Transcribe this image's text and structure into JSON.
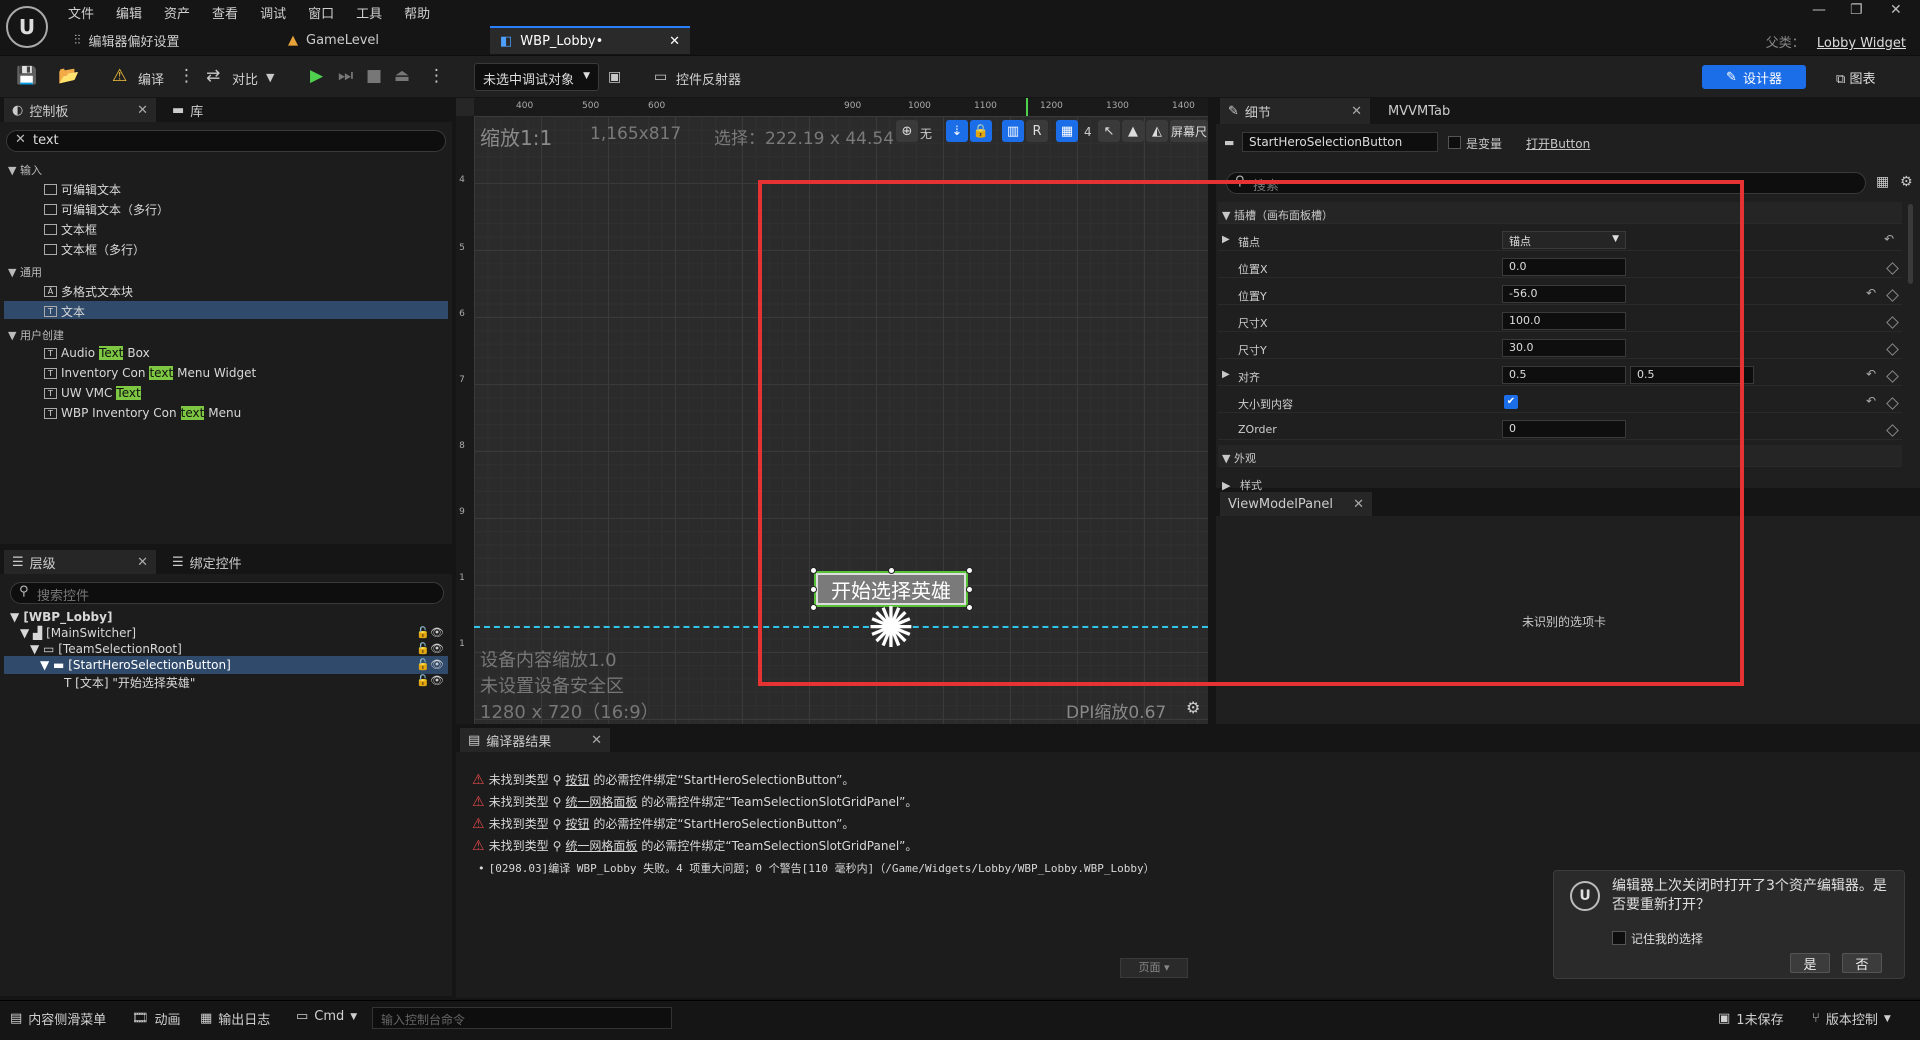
{
  "menu": [
    "文件",
    "编辑",
    "资产",
    "查看",
    "调试",
    "窗口",
    "工具",
    "帮助"
  ],
  "doc_tabs": {
    "prefs": "编辑器偏好设置",
    "level": "GameLevel",
    "lobby": "WBP_Lobby•"
  },
  "parent": {
    "label": "父类：",
    "value": "Lobby Widget"
  },
  "toolbar": {
    "compile": "编译",
    "diff": "对比",
    "debug_object": "未选中调试对象",
    "widget_reflector": "控件反射器",
    "designer": "设计器",
    "graph": "图表"
  },
  "palette": {
    "tab_label": "控制板",
    "library_label": "库",
    "search_value": "text",
    "categories": {
      "input": "输入",
      "common": "通用",
      "user": "用户创建"
    },
    "input_items": [
      "可编辑文本",
      "可编辑文本（多行）",
      "文本框",
      "文本框（多行）"
    ],
    "common_items": [
      "多格式文本块",
      "文本"
    ],
    "user_items": [
      {
        "pre": "Audio ",
        "hl": "Text",
        "post": " Box"
      },
      {
        "pre": "Inventory Con",
        "hl": "text",
        "post": " Menu Widget"
      },
      {
        "pre": "UW VMC",
        "hl": "Text",
        "post": ""
      },
      {
        "pre": "WBP Inventory Con",
        "hl": "text",
        "post": " Menu"
      }
    ]
  },
  "hierarchy": {
    "tab_label": "层级",
    "bind_label": "绑定控件",
    "search_placeholder": "搜索控件",
    "nodes": [
      "[WBP_Lobby]",
      "[MainSwitcher]",
      "[TeamSelectionRoot]",
      "[StartHeroSelectionButton]",
      "[文本] \"开始选择英雄\""
    ]
  },
  "canvas": {
    "zoom": "缩放1:1",
    "resolution": "1,165x817",
    "selection": "选择：222.19 x 44.54",
    "none_label": "无",
    "r_label": "R",
    "grid_num": "4",
    "screen_label": "屏幕尺",
    "ruler_x": [
      "400",
      "500",
      "600",
      "900",
      "1000",
      "1100",
      "1200",
      "1300",
      "1400"
    ],
    "ruler_y": [
      "4",
      "5",
      "6",
      "7",
      "8",
      "9",
      "1",
      "1"
    ],
    "device_scale": "设备内容缩放1.0",
    "safe_zone": "未设置设备安全区",
    "device_res": "1280 x 720（16:9）",
    "dpi": "DPI缩放0.67",
    "button_text": "开始选择英雄"
  },
  "details": {
    "tab_label": "细节",
    "mvvm_tab": "MVVMTab",
    "widget_name": "StartHeroSelectionButton",
    "is_variable": "是变量",
    "open_link": "打开Button",
    "search_placeholder": "搜索",
    "slot_section": "插槽（画布面板槽）",
    "rows": [
      {
        "label": "锚点",
        "value": "锚点"
      },
      {
        "label": "位置X",
        "value": "0.0"
      },
      {
        "label": "位置Y",
        "value": "-56.0"
      },
      {
        "label": "尺寸X",
        "value": "100.0"
      },
      {
        "label": "尺寸Y",
        "value": "30.0"
      },
      {
        "label": "对齐",
        "value": "0.5",
        "value2": "0.5"
      },
      {
        "label": "大小到内容",
        "value": "✔"
      },
      {
        "label": "ZOrder",
        "value": "0"
      }
    ],
    "appearance": "外观",
    "style": "样式"
  },
  "viewmodel": {
    "tab_label": "ViewModelPanel",
    "message": "未识别的选项卡"
  },
  "compile": {
    "tab_label": "编译器结果",
    "errors": [
      {
        "pre": "未找到类型",
        "type": "按钮",
        "mid": "的必需控件绑定“StartHeroSelectionButton”。"
      },
      {
        "pre": "未找到类型",
        "type": "统一网格面板",
        "mid": "的必需控件绑定“TeamSelectionSlotGridPanel”。"
      },
      {
        "pre": "未找到类型",
        "type": "按钮",
        "mid": "的必需控件绑定“StartHeroSelectionButton”。"
      },
      {
        "pre": "未找到类型",
        "type": "统一网格面板",
        "mid": "的必需控件绑定“TeamSelectionSlotGridPanel”。"
      }
    ],
    "summary": "[0298.03]编译 WBP_Lobby 失败。4 项重大问题；0 个警告[110 毫秒内]（/Game/Widgets/Lobby/WBP_Lobby.WBP_Lobby）",
    "page": "页面"
  },
  "notification": {
    "message": "编辑器上次关闭时打开了3个资产编辑器。是否要重新打开？",
    "remember": "记住我的选择",
    "yes": "是",
    "no": "否"
  },
  "status": {
    "content_drawer": "内容侧滑菜单",
    "animation": "动画",
    "output_log": "输出日志",
    "cmd": "Cmd",
    "console_placeholder": "输入控制台命令",
    "unsaved": "1未保存",
    "source_control": "版本控制"
  },
  "colors": {
    "accent": "#1b6ee8",
    "highlight": "#7dc742",
    "error": "#e04848",
    "annotation": "#e53333"
  }
}
